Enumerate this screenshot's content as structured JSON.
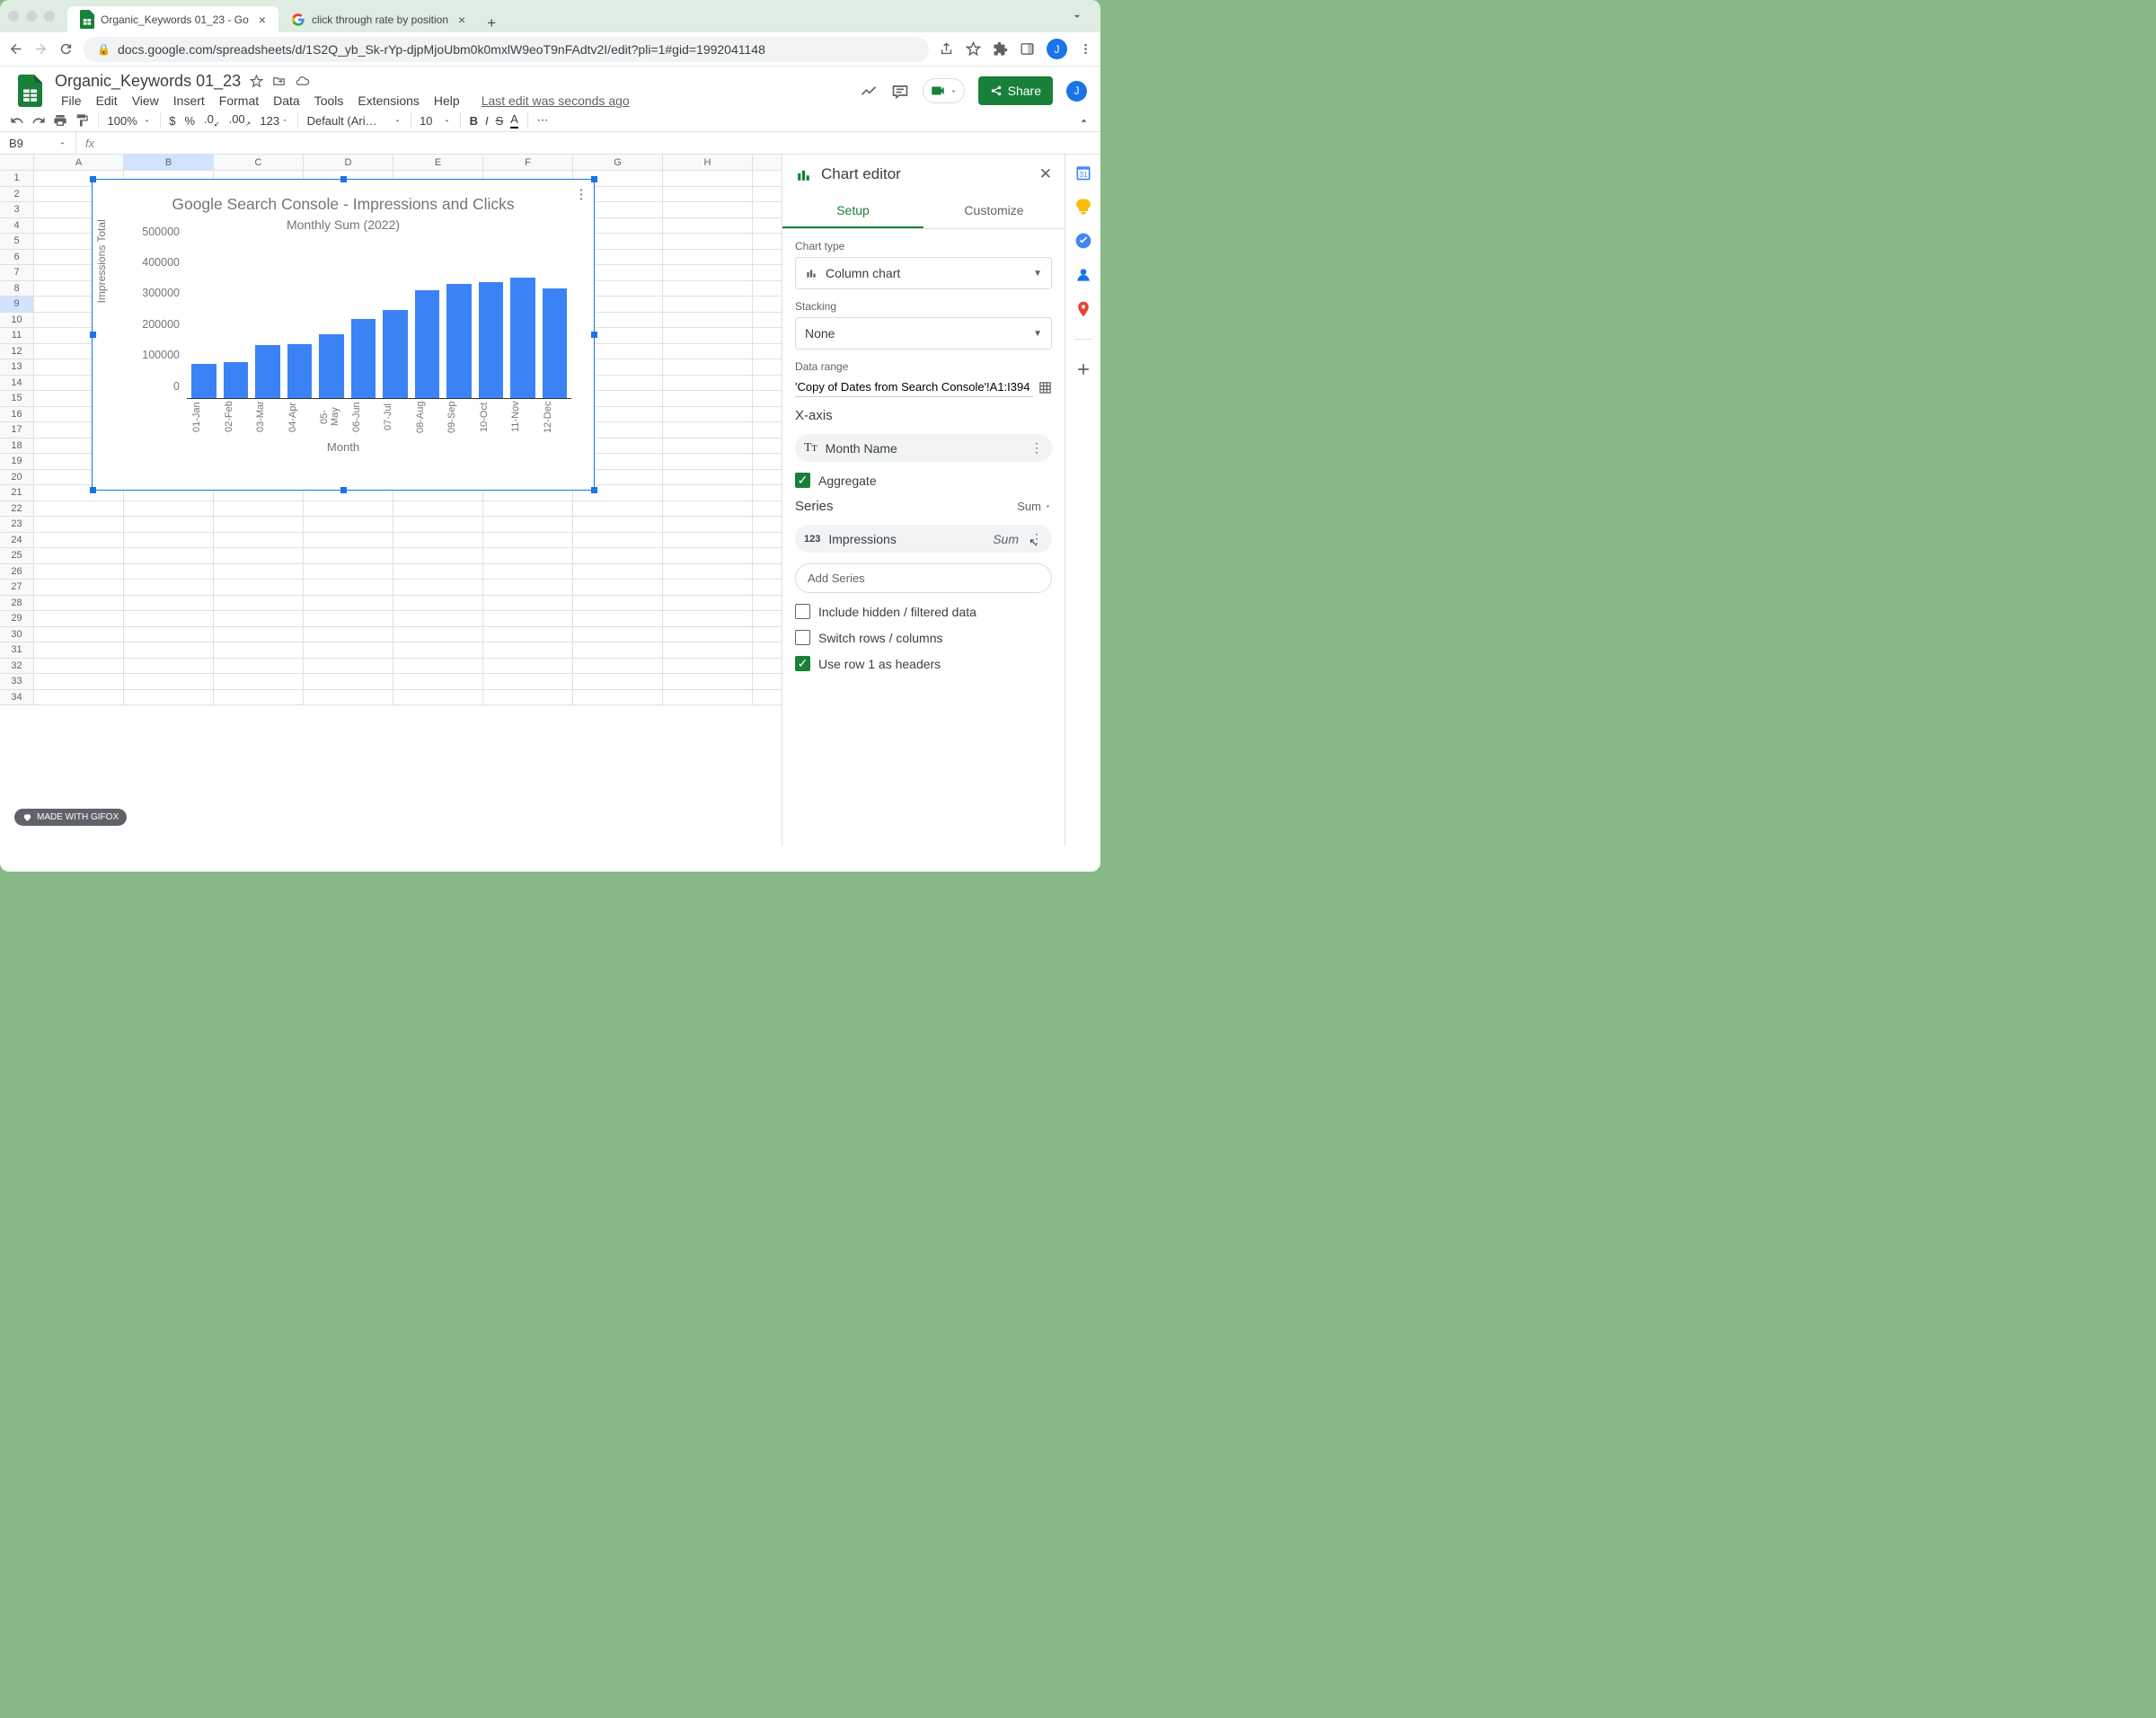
{
  "browser": {
    "tabs": [
      {
        "title": "Organic_Keywords 01_23 - Go",
        "active": true,
        "favicon": "sheets"
      },
      {
        "title": "click through rate by position",
        "active": false,
        "favicon": "google"
      }
    ],
    "url": "docs.google.com/spreadsheets/d/1S2Q_yb_Sk-rYp-djpMjoUbm0k0mxlW9eoT9nFAdtv2I/edit?pli=1#gid=1992041148"
  },
  "doc": {
    "title": "Organic_Keywords 01_23",
    "menus": [
      "File",
      "Edit",
      "View",
      "Insert",
      "Format",
      "Data",
      "Tools",
      "Extensions",
      "Help"
    ],
    "last_edit": "Last edit was seconds ago",
    "share": "Share",
    "avatar": "J"
  },
  "toolbar": {
    "zoom": "100%",
    "currency": "$",
    "percent": "%",
    "dec_dec": ".0",
    "dec_inc": ".00",
    "numfmt": "123",
    "font": "Default (Ari…",
    "fontsize": "10"
  },
  "namebox": {
    "cell": "B9"
  },
  "columns": [
    "A",
    "B",
    "C",
    "D",
    "E",
    "F",
    "G",
    "H"
  ],
  "rows_count": 34,
  "chart_data": {
    "type": "bar",
    "title": "Google Search Console - Impressions and Clicks",
    "subtitle": "Monthly Sum (2022)",
    "ylabel": "Impressions Total",
    "xlabel": "Month",
    "ylim": [
      0,
      500000
    ],
    "yticks": [
      0,
      100000,
      200000,
      300000,
      400000,
      500000
    ],
    "categories": [
      "01-Jan",
      "02-Feb",
      "03-Mar",
      "04-Apr",
      "05-May",
      "06-Jun",
      "07-Jul",
      "08-Aug",
      "09-Sep",
      "10-Oct",
      "11-Nov",
      "12-Dec"
    ],
    "values": [
      110000,
      115000,
      170000,
      175000,
      205000,
      255000,
      285000,
      350000,
      370000,
      375000,
      390000,
      355000
    ]
  },
  "editor": {
    "title": "Chart editor",
    "tabs": {
      "setup": "Setup",
      "customize": "Customize"
    },
    "chart_type_label": "Chart type",
    "chart_type": "Column chart",
    "stacking_label": "Stacking",
    "stacking": "None",
    "data_range_label": "Data range",
    "data_range": "'Copy of Dates from Search Console'!A1:I394",
    "xaxis_label": "X-axis",
    "xaxis_field": "Month Name",
    "aggregate": "Aggregate",
    "series_label": "Series",
    "series_agg": "Sum",
    "series_field": "Impressions",
    "series_field_agg": "Sum",
    "add_series": "Add Series",
    "include_hidden": "Include hidden / filtered data",
    "switch_rc": "Switch rows / columns",
    "row1_headers": "Use row 1 as headers"
  },
  "gifox": "MADE WITH GIFOX"
}
